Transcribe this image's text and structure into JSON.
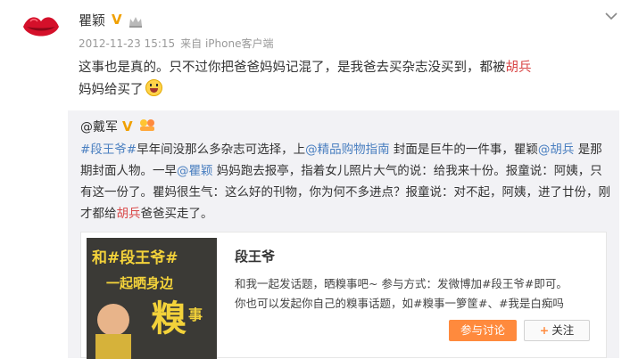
{
  "post": {
    "author": "瞿颖",
    "verified_mark": "V",
    "timestamp": "2012-11-23 15:15",
    "source": "来自 iPhone客户端",
    "text_before": "这事也是真的。只不过你把爸爸妈妈记混了，是我爸去买杂志没买到，都被",
    "mention": "胡兵",
    "text_after": "妈妈给买了"
  },
  "repost": {
    "author": "@戴军",
    "verified_mark": "V",
    "segments": [
      {
        "t": "#段王爷#",
        "c": "link"
      },
      {
        "t": "早年间没那么多杂志可选择，上",
        "c": ""
      },
      {
        "t": "@精品购物指南",
        "c": "link"
      },
      {
        "t": " 封面是巨牛的一件事，瞿颖",
        "c": ""
      },
      {
        "t": "@胡兵",
        "c": "link"
      },
      {
        "t": " 是那期封面人物。一早",
        "c": ""
      },
      {
        "t": "@瞿颖",
        "c": "link"
      },
      {
        "t": " 妈妈跑去报亭，指着女儿照片大气的说：给我来十份。报童说：阿姨，只有这一份了。瞿妈很生气：这么好的刊物，你为何不多进点？报童说：对不起，阿姨，进了廿份，刚才都给",
        "c": ""
      },
      {
        "t": "胡兵",
        "c": "hl"
      },
      {
        "t": "爸爸买走了。",
        "c": ""
      }
    ]
  },
  "card": {
    "image_text_top": "和#段王爷#",
    "image_text_mid": "一起晒身边",
    "image_text_big": "糗",
    "image_text_small": "事",
    "title": "段王爷",
    "desc_line1": "和我一起发话题，晒糗事吧~ 参与方式：发微博加#段王爷#即可。",
    "desc_line2": "你也可以发起你自己的糗事话题，如#糗事一箩筐#、#我是白痴吗",
    "join_label": "参与讨论",
    "follow_label": "关注"
  },
  "icons": {
    "avatar": "lips-icon",
    "crown": "crown-icon",
    "chevron": "chevron-down-icon",
    "emoji": "laughing-emoji-icon"
  }
}
